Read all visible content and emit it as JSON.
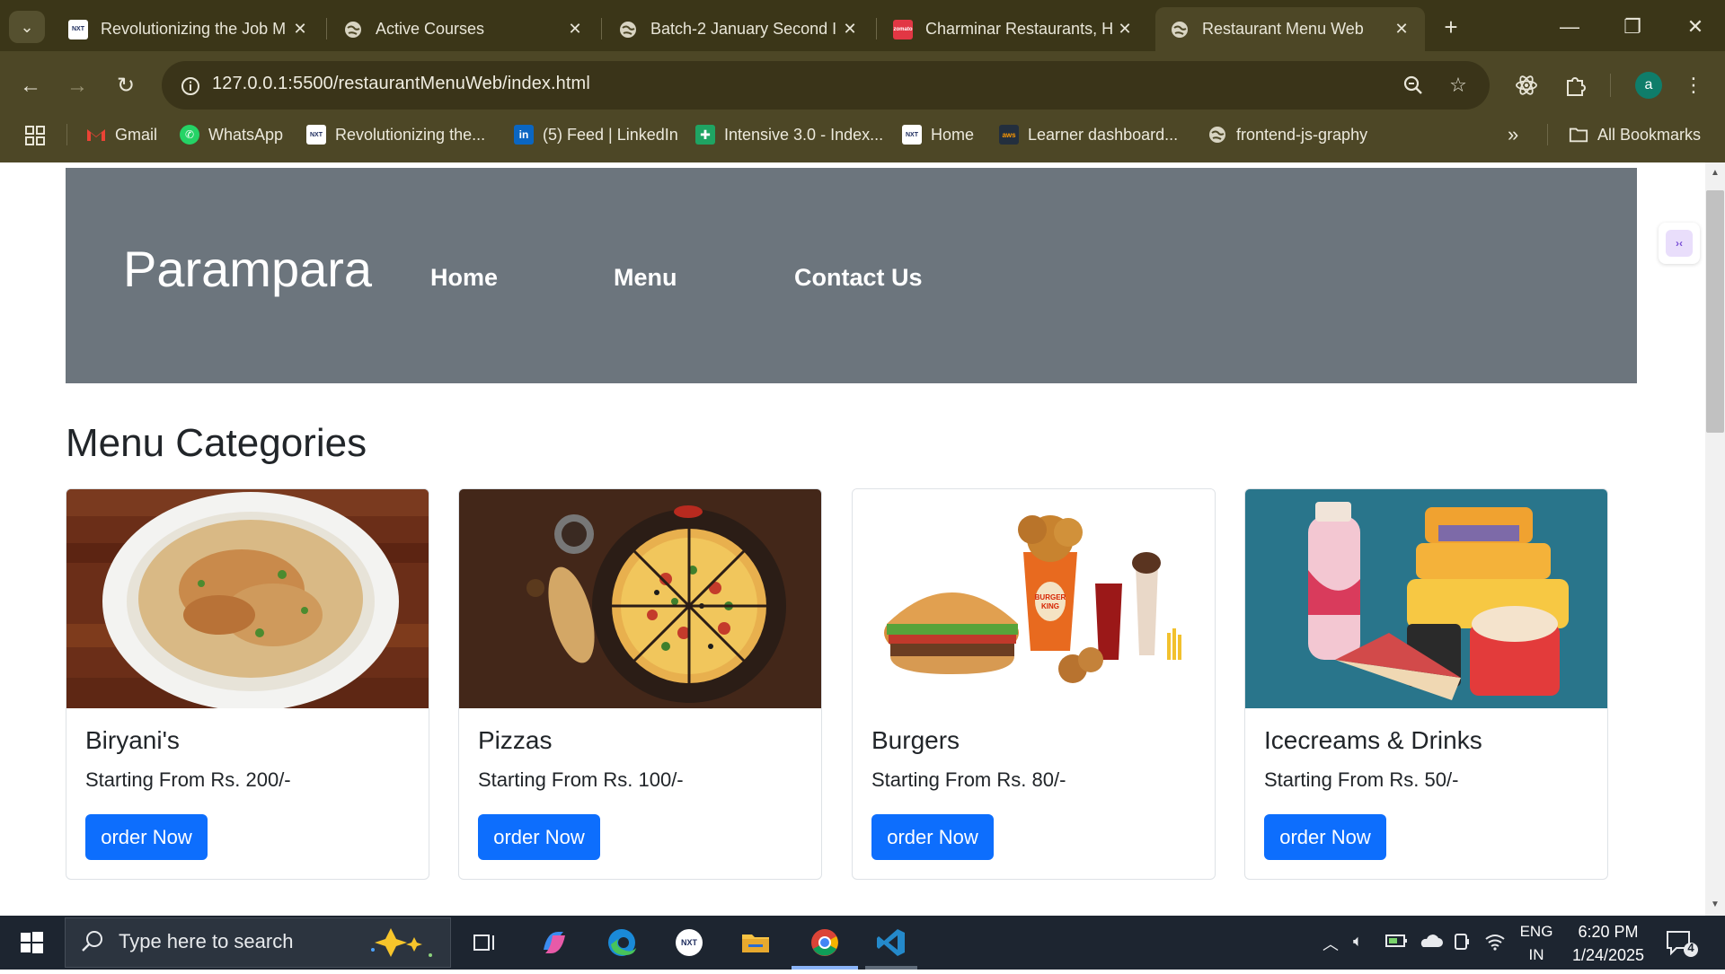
{
  "browser": {
    "tabs": [
      {
        "title": "Revolutionizing the Job M",
        "favicon": "nxtwave-icon",
        "active": false
      },
      {
        "title": "Active Courses",
        "favicon": "globe-icon",
        "active": false
      },
      {
        "title": "Batch-2 January Second I",
        "favicon": "globe-icon",
        "active": false
      },
      {
        "title": "Charminar Restaurants, H",
        "favicon": "zomato-icon",
        "active": false
      },
      {
        "title": "Restaurant Menu Web",
        "favicon": "globe-icon",
        "active": true
      }
    ],
    "url": "127.0.0.1:5500/restaurantMenuWeb/index.html",
    "profile_initial": "a",
    "bookmarks": [
      {
        "label": "Gmail",
        "icon": "gmail-icon"
      },
      {
        "label": "WhatsApp",
        "icon": "whatsapp-icon"
      },
      {
        "label": "Revolutionizing the...",
        "icon": "nxtwave-icon"
      },
      {
        "label": "(5) Feed | LinkedIn",
        "icon": "linkedin-icon"
      },
      {
        "label": "Intensive 3.0 - Index...",
        "icon": "sheets-icon"
      },
      {
        "label": "Home",
        "icon": "nxtwave-icon"
      },
      {
        "label": "Learner dashboard...",
        "icon": "aws-icon"
      },
      {
        "label": "frontend-js-graphy",
        "icon": "globe-icon"
      }
    ],
    "all_bookmarks_label": "All Bookmarks"
  },
  "site": {
    "brand": "Parampara",
    "nav": [
      "Home",
      "Menu",
      "Contact Us"
    ],
    "section_title": "Menu Categories",
    "cards": [
      {
        "title": "Biryani's",
        "price_text": "Starting From Rs. 200/-",
        "button": "order Now",
        "image": "biryani-plate"
      },
      {
        "title": "Pizzas",
        "price_text": "Starting From Rs. 100/-",
        "button": "order Now",
        "image": "pizza-board"
      },
      {
        "title": "Burgers",
        "price_text": "Starting From Rs. 80/-",
        "button": "order Now",
        "image": "burger-king-meal"
      },
      {
        "title": "Icecreams & Drinks",
        "price_text": "Starting From Rs. 50/-",
        "button": "order Now",
        "image": "icecream-tubs"
      }
    ],
    "colors": {
      "navbar_bg": "#6c757d",
      "button_bg": "#0d6efd"
    }
  },
  "taskbar": {
    "search_placeholder": "Type here to search",
    "lang_line1": "ENG",
    "lang_line2": "IN",
    "time": "6:20 PM",
    "date": "1/24/2025",
    "notifications": "4"
  }
}
